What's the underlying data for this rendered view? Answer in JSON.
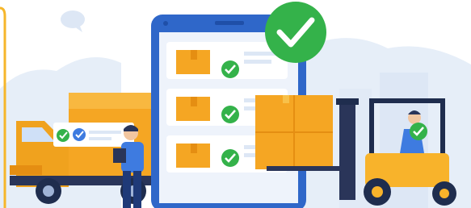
{
  "illustration": {
    "theme": "warehouse-logistics-checklist",
    "colors": {
      "background": "#ffffff",
      "skyline": "#e6eef8",
      "tablet_frame": "#2f67c9",
      "tablet_screen": "#eef3fb",
      "box_orange": "#f5a623",
      "box_orange_dark": "#e58e12",
      "check_green": "#34b24a",
      "forklift_yellow": "#f8b32b",
      "forklift_dark": "#1f2d4e",
      "truck_orange": "#f5a623",
      "truck_cab": "#f0a21e",
      "worker_shirt": "#3e7be0",
      "worker_pants": "#1f3a78",
      "frame_accent": "#f6b62a"
    },
    "icons": [
      "check-icon",
      "chat-bubble-icon",
      "package-icon"
    ]
  }
}
